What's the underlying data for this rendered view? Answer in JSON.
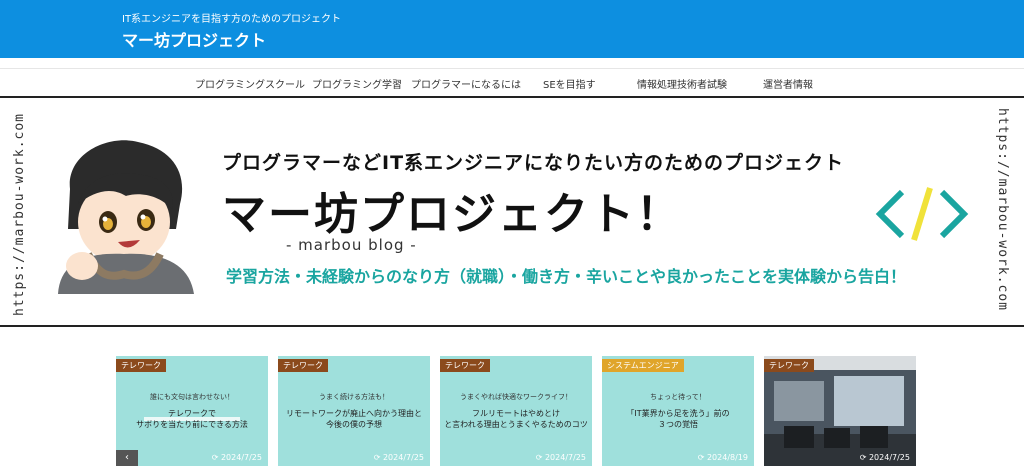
{
  "header": {
    "tagline": "IT系エンジニアを目指す方のためのプロジェクト",
    "title": "マー坊プロジェクト",
    "background": "#0d8fe0"
  },
  "nav": {
    "items": [
      {
        "label": "プログラミングスクール"
      },
      {
        "label": "プログラミング学習"
      },
      {
        "label": "プログラマーになるには"
      },
      {
        "label": "SEを目指す"
      },
      {
        "label": "情報処理技術者試験"
      },
      {
        "label": "運営者情報"
      }
    ]
  },
  "banner": {
    "url_left": "https://marbou-work.com",
    "url_right": "https://marbou-work.com",
    "headline": "プログラマーなどIT系エンジニアになりたい方のためのプロジェクト",
    "title": "マー坊プロジェクト！",
    "subtitle": "- marbou blog -",
    "description": "学習方法・未経験からのなり方（就職）・働き方・辛いことや良かったことを実体験から告白！",
    "accent": "#1aa5a0",
    "code_icon": "code-brackets-icon"
  },
  "cards": [
    {
      "category": "テレワーク",
      "line1": "誰にも文句は言わせない！",
      "line2": "テレワークで",
      "line3": "サボりを当たり前にできる方法",
      "date": "2024/7/25"
    },
    {
      "category": "テレワーク",
      "line1": "うまく続ける方法も！",
      "line2": "リモートワークが廃止へ向かう理由と",
      "line3": "今後の僕の予想",
      "date": "2024/7/25"
    },
    {
      "category": "テレワーク",
      "line1": "うまくやれば快適なワークライフ！",
      "line2": "フルリモートはやめとけ",
      "line3": "と言われる理由とうまくやるためのコツ",
      "date": "2024/7/25"
    },
    {
      "category": "システムエンジニア",
      "line1": "ちょっと待って！",
      "line2": "「IT業界から足を洗う」前の",
      "line3": "３つの覚悟",
      "date": "2024/8/19"
    },
    {
      "category": "テレワーク",
      "line1": "",
      "line2": "",
      "line3": "",
      "date": "2024/7/25"
    }
  ],
  "carousel": {
    "prev_icon": "chevron-left-icon",
    "prev_label": "‹"
  },
  "refresh_icon": "refresh-icon"
}
